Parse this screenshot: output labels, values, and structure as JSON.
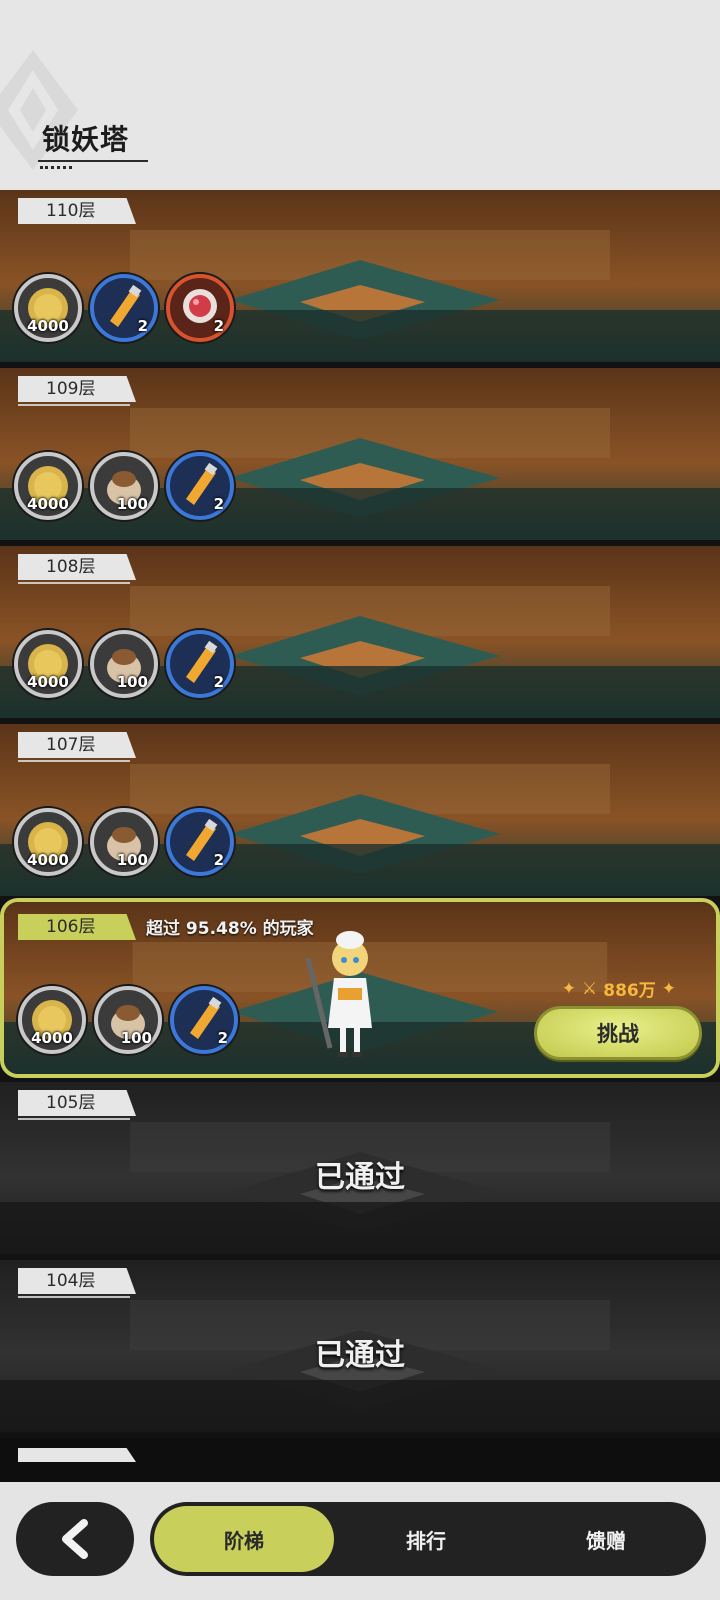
{
  "header": {
    "title": "锁妖塔"
  },
  "floors": [
    {
      "label": "110层",
      "rewards": [
        {
          "icon": "gold-coin-icon",
          "qty": "4000",
          "border": "grey"
        },
        {
          "icon": "potion-vial-icon",
          "qty": "2",
          "border": "blue"
        },
        {
          "icon": "red-gem-orb-icon",
          "qty": "2",
          "border": "red"
        }
      ]
    },
    {
      "label": "109层",
      "rewards": [
        {
          "icon": "gold-coin-icon",
          "qty": "4000",
          "border": "grey"
        },
        {
          "icon": "grain-sack-icon",
          "qty": "100",
          "border": "grey"
        },
        {
          "icon": "potion-vial-icon",
          "qty": "2",
          "border": "blue"
        }
      ]
    },
    {
      "label": "108层",
      "rewards": [
        {
          "icon": "gold-coin-icon",
          "qty": "4000",
          "border": "grey"
        },
        {
          "icon": "grain-sack-icon",
          "qty": "100",
          "border": "grey"
        },
        {
          "icon": "potion-vial-icon",
          "qty": "2",
          "border": "blue"
        }
      ]
    },
    {
      "label": "107层",
      "rewards": [
        {
          "icon": "gold-coin-icon",
          "qty": "4000",
          "border": "grey"
        },
        {
          "icon": "grain-sack-icon",
          "qty": "100",
          "border": "grey"
        },
        {
          "icon": "potion-vial-icon",
          "qty": "2",
          "border": "blue"
        }
      ]
    },
    {
      "label": "106层",
      "rank_text": "超过 95.48% 的玩家",
      "power": "886万",
      "challenge_label": "挑战",
      "rewards": [
        {
          "icon": "gold-coin-icon",
          "qty": "4000",
          "border": "grey"
        },
        {
          "icon": "grain-sack-icon",
          "qty": "100",
          "border": "grey"
        },
        {
          "icon": "potion-vial-icon",
          "qty": "2",
          "border": "blue"
        }
      ]
    },
    {
      "label": "105层",
      "status": "已通过"
    },
    {
      "label": "104层",
      "status": "已通过"
    }
  ],
  "tabs": {
    "ladder": "阶梯",
    "rank": "排行",
    "gift": "馈赠"
  },
  "colors": {
    "accent": "#c8cf5a",
    "dark": "#222222",
    "power": "#f6b940"
  }
}
